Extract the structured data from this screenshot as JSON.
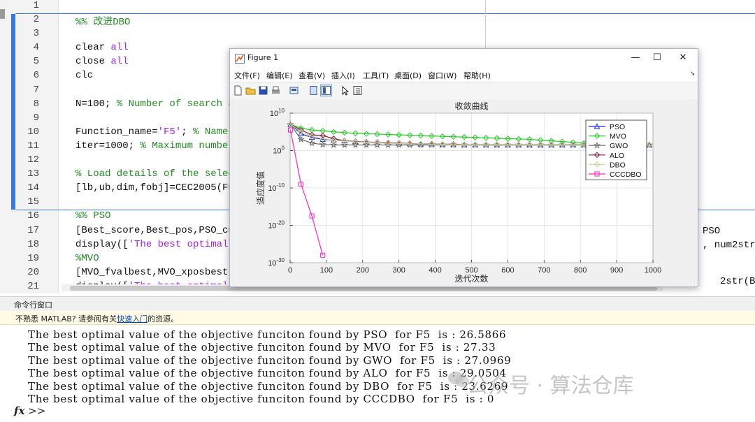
{
  "editor": {
    "line_numbers": [
      "1",
      "2",
      "3",
      "4",
      "5",
      "6",
      "7",
      "8",
      "9",
      "10",
      "11",
      "12",
      "13",
      "14",
      "15",
      "16",
      "17",
      "18",
      "19",
      "20",
      "21"
    ],
    "lines": [
      {
        "parts": []
      },
      {
        "parts": [
          {
            "t": "%% 改进DBO",
            "c": "cm"
          }
        ]
      },
      {
        "parts": []
      },
      {
        "parts": [
          {
            "t": "clear ",
            "c": ""
          },
          {
            "t": "all",
            "c": "kw"
          }
        ]
      },
      {
        "parts": [
          {
            "t": "close ",
            "c": ""
          },
          {
            "t": "all",
            "c": "kw"
          }
        ]
      },
      {
        "parts": [
          {
            "t": "clc",
            "c": ""
          }
        ]
      },
      {
        "parts": []
      },
      {
        "parts": [
          {
            "t": "N=100; ",
            "c": ""
          },
          {
            "t": "% Number of search ag",
            "c": "cm"
          }
        ]
      },
      {
        "parts": []
      },
      {
        "parts": [
          {
            "t": "Function_name=",
            "c": ""
          },
          {
            "t": "'F5'",
            "c": "st"
          },
          {
            "t": "; ",
            "c": ""
          },
          {
            "t": "% Name o",
            "c": "cm"
          }
        ]
      },
      {
        "parts": [
          {
            "t": "iter=1000; ",
            "c": ""
          },
          {
            "t": "% Maximum number ",
            "c": "cm"
          }
        ]
      },
      {
        "parts": []
      },
      {
        "parts": [
          {
            "t": "% Load details of the selecte",
            "c": "cm"
          }
        ]
      },
      {
        "parts": [
          {
            "t": "[lb,ub,dim,fobj]=CEC2005(Func",
            "c": ""
          }
        ]
      },
      {
        "parts": []
      },
      {
        "parts": [
          {
            "t": "%% PSO",
            "c": "cm"
          }
        ]
      },
      {
        "parts": [
          {
            "t": "[Best_score,Best_pos,PSO_cur",
            "c": ""
          }
        ]
      },
      {
        "parts": [
          {
            "t": "display([",
            "c": ""
          },
          {
            "t": "'The best optimal va",
            "c": "st"
          }
        ]
      },
      {
        "parts": [
          {
            "t": "%MVO",
            "c": "cm"
          }
        ]
      },
      {
        "parts": [
          {
            "t": "[MVO_fvalbest,MVO_xposbest,M",
            "c": ""
          }
        ]
      },
      {
        "parts": [
          {
            "t": "display([",
            "c": ""
          },
          {
            "t": "'The best optimal",
            "c": "st"
          }
        ]
      }
    ],
    "right_fragments": [
      {
        "text": "PSO",
        "line": 17
      },
      {
        "text": ", num2str(B",
        "line": 18
      },
      {
        "text": "2str(B",
        "line": 21
      }
    ]
  },
  "figure": {
    "title": "Figure 1",
    "window_buttons": {
      "minimize": "—",
      "maximize": "☐",
      "close": "✕"
    },
    "menu": [
      "文件(F)",
      "编辑(E)",
      "查看(V)",
      "插入(I)",
      "工具(T)",
      "桌面(D)",
      "窗口(W)",
      "帮助(H)"
    ],
    "toolbar_icons": [
      "new-file-icon",
      "open-folder-icon",
      "save-icon",
      "print-icon",
      "export-icon",
      "dock-icon",
      "layout-icon",
      "pointer-icon",
      "property-icon"
    ]
  },
  "chart_data": {
    "type": "line",
    "title": "收敛曲线",
    "xlabel": "迭代次数",
    "ylabel": "适应度值",
    "yscale": "log",
    "xlim": [
      0,
      1000
    ],
    "ylim_exp": [
      -30,
      10
    ],
    "xticks": [
      "0",
      "100",
      "200",
      "300",
      "400",
      "500",
      "600",
      "700",
      "800",
      "900",
      "1000"
    ],
    "yticks": [
      {
        "base": "10",
        "exp": "10",
        "v": 10
      },
      {
        "base": "10",
        "exp": "0",
        "v": 0
      },
      {
        "base": "10",
        "exp": "-10",
        "v": -10
      },
      {
        "base": "10",
        "exp": "-20",
        "v": -20
      },
      {
        "base": "10",
        "exp": "-30",
        "v": -30
      }
    ],
    "legend_position": "top-right",
    "series": [
      {
        "name": "PSO",
        "color": "#1f2fd6",
        "marker": "triangle",
        "x": [
          1,
          30,
          60,
          90,
          120,
          150,
          180,
          210,
          240,
          270,
          300,
          330,
          360,
          390,
          420,
          450,
          480,
          510,
          540,
          570,
          600,
          630,
          660,
          690,
          720,
          750,
          780,
          810,
          840,
          870,
          900,
          930,
          960,
          990
        ],
        "logy": [
          7,
          4.5,
          3.5,
          3,
          2.8,
          2.6,
          2.4,
          2.2,
          2.1,
          2,
          1.9,
          1.8,
          1.7,
          1.7,
          1.6,
          1.6,
          1.5,
          1.5,
          1.5,
          1.5,
          1.5,
          1.5,
          1.5,
          1.5,
          1.5,
          1.5,
          1.5,
          1.5,
          1.5,
          1.5,
          1.5,
          1.5,
          1.5,
          1.5
        ]
      },
      {
        "name": "MVO",
        "color": "#22cc22",
        "marker": "diamond",
        "x": [
          1,
          30,
          60,
          90,
          120,
          150,
          180,
          210,
          240,
          270,
          300,
          330,
          360,
          390,
          420,
          450,
          480,
          510,
          540,
          570,
          600,
          630,
          660,
          690,
          720,
          750,
          780,
          810,
          840,
          870,
          900,
          930,
          960,
          990
        ],
        "logy": [
          7,
          6,
          5.5,
          5.3,
          5,
          4.8,
          4.6,
          4.5,
          4.4,
          4.3,
          4.2,
          4.1,
          4,
          3.9,
          3.8,
          3.7,
          3.6,
          3.5,
          3.4,
          3.3,
          3.2,
          3.1,
          3,
          2.8,
          2.6,
          2.4,
          2.2,
          2,
          1.9,
          1.8,
          1.7,
          1.6,
          1.5,
          1.5
        ]
      },
      {
        "name": "GWO",
        "color": "#6a6a6a",
        "marker": "star",
        "x": [
          1,
          30,
          60,
          90,
          120,
          150,
          180,
          210,
          240,
          270,
          300,
          330,
          360,
          390,
          420,
          450,
          480,
          510,
          540,
          570,
          600,
          630,
          660,
          690,
          720,
          750,
          780,
          810,
          840,
          870,
          900,
          930,
          960,
          990
        ],
        "logy": [
          7,
          3,
          2,
          1.6,
          1.5,
          1.5,
          1.5,
          1.5,
          1.5,
          1.5,
          1.5,
          1.5,
          1.5,
          1.5,
          1.5,
          1.5,
          1.5,
          1.5,
          1.5,
          1.5,
          1.5,
          1.5,
          1.5,
          1.5,
          1.5,
          1.5,
          1.5,
          1.5,
          1.5,
          1.5,
          1.5,
          1.5,
          1.5,
          1.5
        ]
      },
      {
        "name": "ALO",
        "color": "#8b1a3a",
        "marker": "diamond",
        "x": [
          1,
          30,
          60,
          90,
          120,
          150,
          180,
          210,
          240,
          270,
          300,
          330,
          360,
          390,
          420,
          450,
          480,
          510,
          540,
          570,
          600,
          630,
          660,
          690,
          720,
          750,
          780,
          810,
          840,
          870,
          900,
          930,
          960,
          990
        ],
        "logy": [
          7,
          5.5,
          4.2,
          4,
          3.2,
          2.6,
          2.4,
          2.3,
          2.2,
          2.1,
          2,
          1.9,
          1.8,
          1.8,
          1.7,
          1.7,
          1.6,
          1.6,
          1.6,
          1.6,
          1.6,
          1.6,
          1.6,
          1.6,
          1.6,
          1.6,
          1.6,
          1.6,
          1.6,
          1.6,
          1.6,
          1.6,
          1.6,
          1.6
        ]
      },
      {
        "name": "DBO",
        "color": "#c8d89a",
        "marker": "diamond",
        "x": [
          1,
          30,
          60,
          90,
          120,
          150,
          180,
          210,
          240,
          270,
          300,
          330,
          360,
          390,
          420,
          450,
          480,
          510,
          540,
          570,
          600,
          630,
          660,
          690,
          720,
          750,
          780,
          810,
          840,
          870,
          900,
          930,
          960,
          990
        ],
        "logy": [
          7,
          5,
          3.8,
          3.2,
          2.8,
          2.5,
          2.3,
          2.2,
          2.1,
          2,
          1.9,
          1.8,
          1.8,
          1.7,
          1.7,
          1.6,
          1.6,
          1.6,
          1.6,
          1.6,
          1.6,
          1.6,
          1.6,
          1.6,
          1.6,
          1.6,
          1.6,
          1.6,
          1.6,
          1.6,
          1.6,
          1.6,
          1.6,
          1.6
        ]
      },
      {
        "name": "CCCDBO",
        "color": "#ff22cc",
        "marker": "square",
        "x": [
          1,
          30,
          60,
          90
        ],
        "logy": [
          5.5,
          -9,
          -17.5,
          -28
        ]
      }
    ]
  },
  "command_window": {
    "title": "命令行窗口",
    "notice_prefix": "不熟悉 MATLAB? 请参阅有关",
    "notice_link": "快速入门",
    "notice_suffix": "的资源。",
    "output": [
      "The best optimal value of the objective funciton found by PSO  for F5  is : 26.5866",
      "The best optimal value of the objective funciton found by MVO  for F5  is : 27.33",
      "The best optimal value of the objective funciton found by GWO  for F5  is : 27.0969",
      "The best optimal value of the objective funciton found by ALO  for F5  is : 29.0504",
      "The best optimal value of the objective funciton found by DBO  for F5  is : 23.6269",
      "The best optimal value of the objective funciton found by CCCDBO  for F5  is : 0"
    ],
    "prompt_fx": "fx",
    "prompt": ">>"
  },
  "watermark": "公众号 · 算法仓库"
}
